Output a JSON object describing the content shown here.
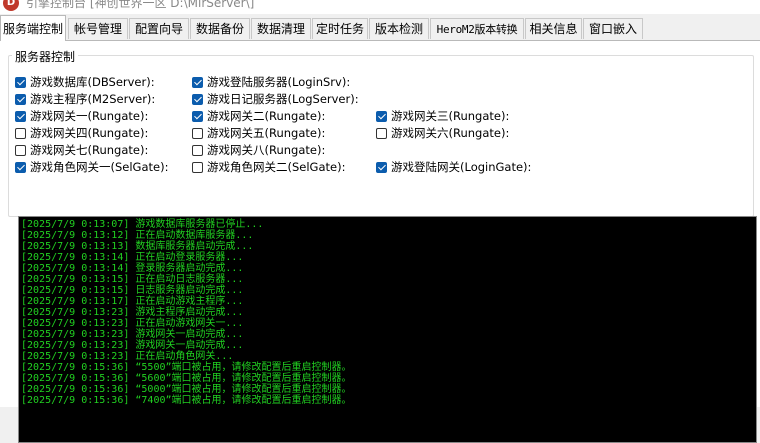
{
  "window": {
    "title": "引擎控制台 [神创世界一区 D:\\MirServer\\]",
    "icon_letter": "D"
  },
  "tabs": [
    "服务端控制",
    "帐号管理",
    "配置向导",
    "数据备份",
    "数据清理",
    "定时任务",
    "版本检测",
    "HeroM2版本转换",
    "相关信息",
    "窗口嵌入"
  ],
  "group": {
    "title": "服务器控制",
    "checkboxes": [
      {
        "label": "游戏数据库(DBServer):",
        "checked": true
      },
      {
        "label": "游戏登陆服务器(LoginSrv):",
        "checked": true
      },
      {
        "label": "游戏主程序(M2Server):",
        "checked": true
      },
      {
        "label": "游戏日记服务器(LogServer):",
        "checked": true
      },
      {
        "label": "游戏网关一(Rungate):",
        "checked": true
      },
      {
        "label": "游戏网关二(Rungate):",
        "checked": true
      },
      {
        "label": "游戏网关三(Rungate):",
        "checked": true
      },
      {
        "label": "游戏网关四(Rungate):",
        "checked": false
      },
      {
        "label": "游戏网关五(Rungate):",
        "checked": false
      },
      {
        "label": "游戏网关六(Rungate):",
        "checked": false
      },
      {
        "label": "游戏网关七(Rungate):",
        "checked": false
      },
      {
        "label": "游戏网关八(Rungate):",
        "checked": false
      },
      {
        "label": "游戏角色网关一(SelGate):",
        "checked": true
      },
      {
        "label": "游戏角色网关二(SelGate):",
        "checked": false
      },
      {
        "label": "游戏登陆网关(LoginGate):",
        "checked": true
      }
    ]
  },
  "log": {
    "text_color": "#21d021",
    "lines": [
      "[2025/7/9 0:13:07] 游戏数据库服务器已停止...",
      "[2025/7/9 0:13:12] 正在启动数据库服务器...",
      "[2025/7/9 0:13:13] 数据库服务器启动完成...",
      "[2025/7/9 0:13:14] 正在启动登录服务器...",
      "[2025/7/9 0:13:14] 登录服务器启动完成...",
      "[2025/7/9 0:13:15] 正在启动日志服务器...",
      "[2025/7/9 0:13:15] 日志服务器启动完成...",
      "[2025/7/9 0:13:17] 正在启动游戏主程序...",
      "[2025/7/9 0:13:23] 游戏主程序启动完成...",
      "[2025/7/9 0:13:23] 正在启动游戏网关一...",
      "[2025/7/9 0:13:23] 游戏网关一启动完成...",
      "[2025/7/9 0:13:23] 游戏网关一启动完成...",
      "[2025/7/9 0:13:23] 正在启动角色网关...",
      "[2025/7/9 0:15:36] “5500”端口被占用，请修改配置后重启控制器。",
      "[2025/7/9 0:15:36] “5600”端口被占用，请修改配置后重启控制器。",
      "[2025/7/9 0:15:36] “5000”端口被占用，请修改配置后重启控制器。",
      "[2025/7/9 0:15:36] “7400”端口被占用，请修改配置后重启控制器。"
    ]
  }
}
